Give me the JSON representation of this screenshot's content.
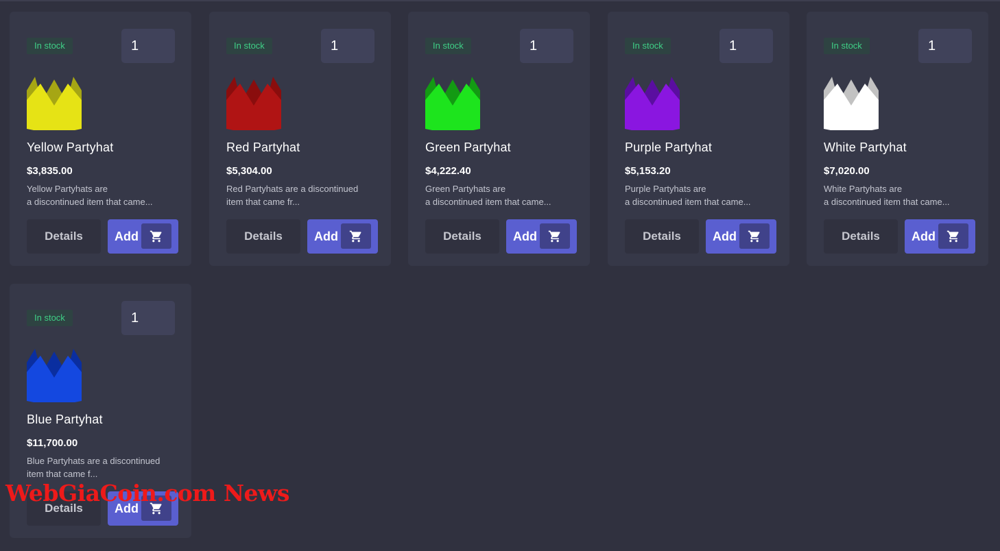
{
  "products": [
    {
      "stock_badge": "In stock",
      "quantity": "1",
      "name": "Yellow Partyhat",
      "price": "$3,835.00",
      "description_line1": "Yellow Partyhats are",
      "description_line2": "a discontinued item that came...",
      "details_label": "Details",
      "add_label": "Add",
      "hat_color": "#e6e315",
      "hat_shade": "#a6a614",
      "icon": "partyhat-icon"
    },
    {
      "stock_badge": "In stock",
      "quantity": "1",
      "name": "Red Partyhat",
      "price": "$5,304.00",
      "description_line1": "Red Partyhats are a discontinued",
      "description_line2": "item that came fr...",
      "details_label": "Details",
      "add_label": "Add",
      "hat_color": "#b01414",
      "hat_shade": "#8a0d0d",
      "icon": "partyhat-icon"
    },
    {
      "stock_badge": "In stock",
      "quantity": "1",
      "name": "Green Partyhat",
      "price": "$4,222.40",
      "description_line1": "Green Partyhats are",
      "description_line2": "a discontinued item that came...",
      "details_label": "Details",
      "add_label": "Add",
      "hat_color": "#1de41d",
      "hat_shade": "#139a13",
      "icon": "partyhat-icon"
    },
    {
      "stock_badge": "In stock",
      "quantity": "1",
      "name": "Purple Partyhat",
      "price": "$5,153.20",
      "description_line1": "Purple Partyhats are",
      "description_line2": "a discontinued item that came...",
      "details_label": "Details",
      "add_label": "Add",
      "hat_color": "#8a16e0",
      "hat_shade": "#5a0ea0",
      "icon": "partyhat-icon"
    },
    {
      "stock_badge": "In stock",
      "quantity": "1",
      "name": "White Partyhat",
      "price": "$7,020.00",
      "description_line1": "White Partyhats are",
      "description_line2": "a discontinued item that came...",
      "details_label": "Details",
      "add_label": "Add",
      "hat_color": "#ffffff",
      "hat_shade": "#c2c2c2",
      "icon": "partyhat-icon"
    },
    {
      "stock_badge": "In stock",
      "quantity": "1",
      "name": "Blue Partyhat",
      "price": "$11,700.00",
      "description_line1": "Blue Partyhats are a discontinued",
      "description_line2": "item that came f...",
      "details_label": "Details",
      "add_label": "Add",
      "hat_color": "#1448e0",
      "hat_shade": "#0a2ea0",
      "icon": "partyhat-icon"
    }
  ],
  "watermark": "WebGiaCoin.com News",
  "colors": {
    "background": "#30313f",
    "card": "#363848",
    "accent": "#5a5fd0",
    "stock_green": "#3fcf86"
  }
}
